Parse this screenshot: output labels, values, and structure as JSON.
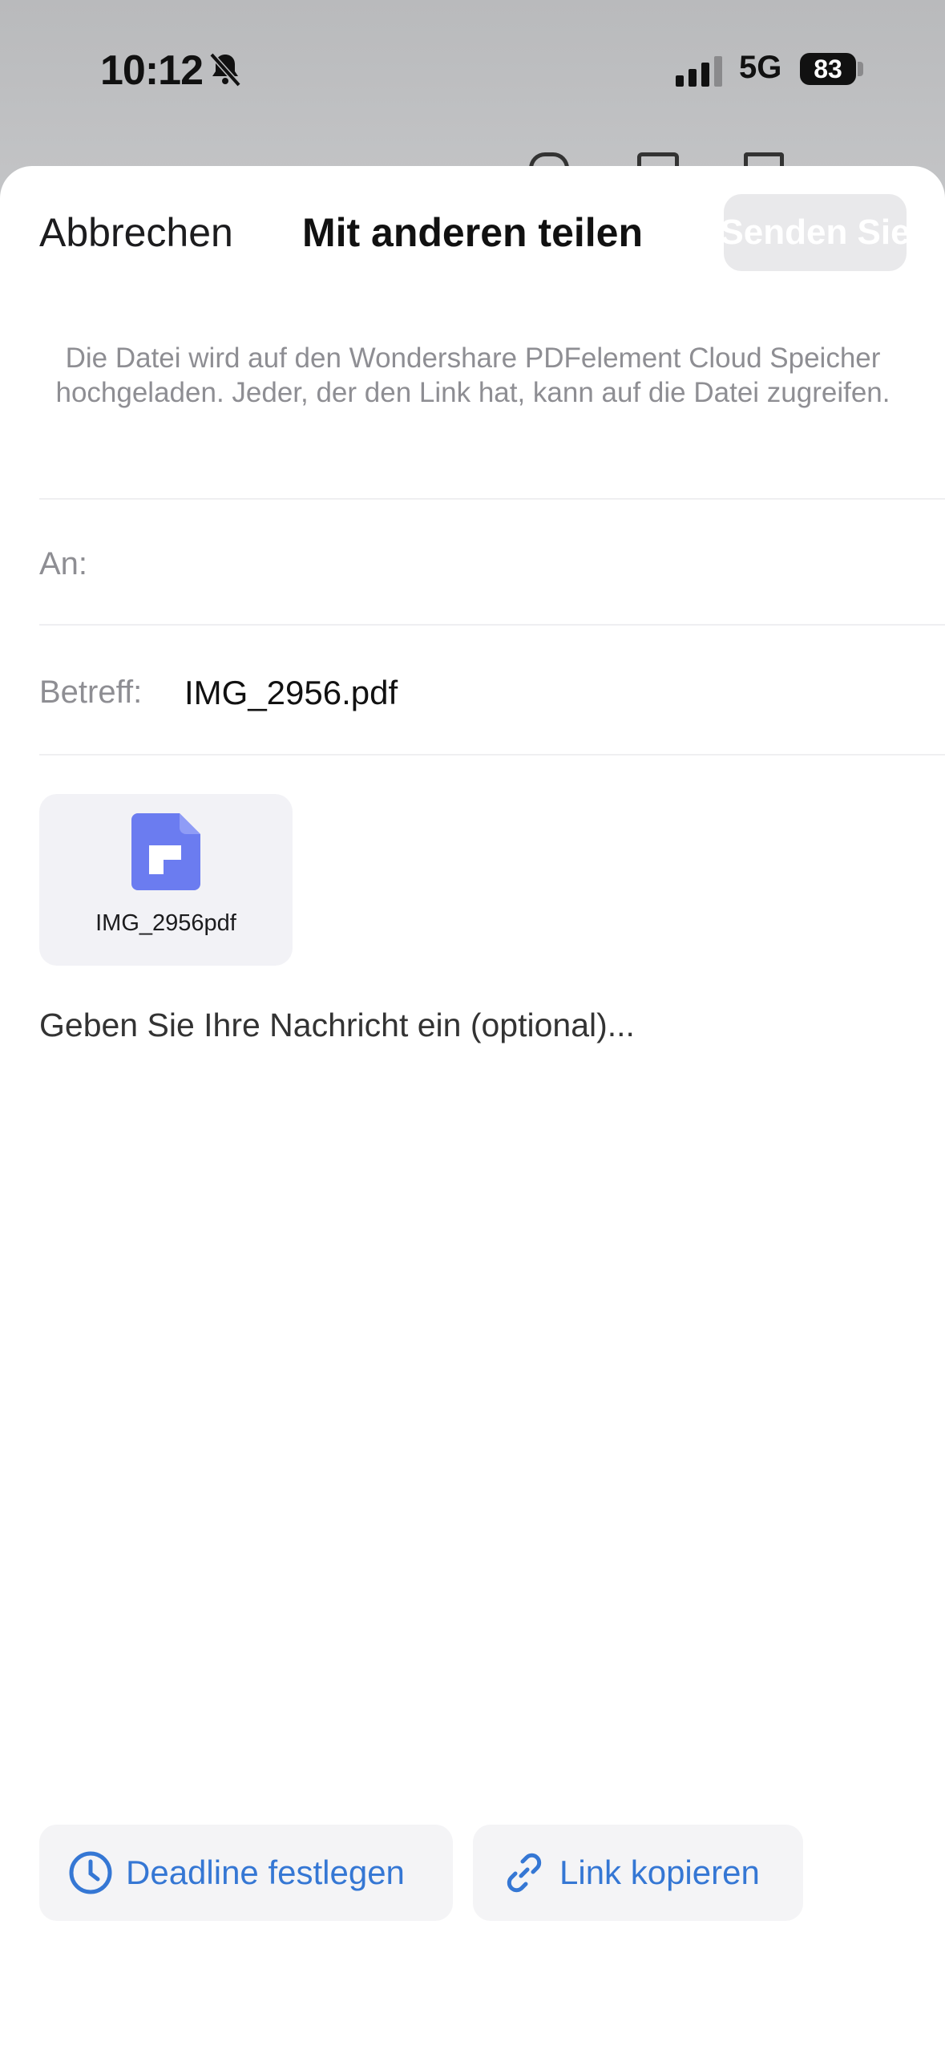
{
  "status_bar": {
    "time": "10:12",
    "network": "5G",
    "battery": "83"
  },
  "nav": {
    "cancel_label": "Abbrechen",
    "title": "Mit anderen teilen",
    "send_label": "Senden Sie"
  },
  "info_text": "Die Datei wird auf den Wondershare PDFelement Cloud Speicher hochgeladen. Jeder, der den Link hat, kann auf die Datei zugreifen.",
  "form": {
    "to_label": "An:",
    "to_value": "",
    "subject_label": "Betreff:",
    "subject_value": "IMG_2956.pdf"
  },
  "attachment": {
    "name": "IMG_2956pdf",
    "icon": "pdf-file-icon"
  },
  "message_placeholder": "Geben Sie Ihre Nachricht ein (optional)...",
  "actions": {
    "deadline_label": "Deadline festlegen",
    "copy_link_label": "Link kopieren"
  },
  "colors": {
    "accent": "#3577d4",
    "file_icon": "#6b7cf0",
    "send_disabled_bg": "#e9e9eb"
  }
}
